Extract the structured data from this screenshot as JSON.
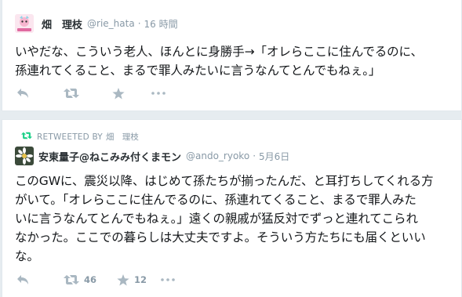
{
  "tweet1": {
    "display_name": "畑　理枝",
    "handle": "@rie_hata",
    "separator": "·",
    "time": "16 時間",
    "text": "いやだな、こういう老人、ほんとに身勝手→「オレらここに住んでるのに、\n孫連れてくること、まるで罪人みたいに言うなんてとんでもねぇ。」",
    "reply_count": "",
    "retweet_count": "",
    "like_count": ""
  },
  "tweet2": {
    "retweeted_by_label": "RETWEETED BY",
    "retweeted_by_user": "畑　理枝",
    "display_name": "安東量子@ねこみみ付くまモン",
    "handle": "@ando_ryoko",
    "separator": "·",
    "time": "5月6日",
    "text": "このGWに、震災以降、はじめて孫たちが揃ったんだ、と耳打ちしてくれる方\nがいて。「オレらここに住んでるのに、孫連れてくること、まるで罪人みた\nいに言うなんてとんでもねぇ。」遠くの親戚が猛反対でずっと連れてこられ\nなかった。ここでの暮らしは大丈夫ですよ。そういう方たちにも届くといい\nな。",
    "retweet_count": "46",
    "like_count": "12"
  },
  "icons": {
    "reply": "reply-icon",
    "retweet": "retweet-icon",
    "favorite": "star-icon",
    "more": "more-icon"
  },
  "colors": {
    "background": "#e6ecf0",
    "card": "#ffffff",
    "text": "#14171a",
    "muted": "#8899a6",
    "icon": "#aab8c2",
    "retweet_green": "#19cf86"
  }
}
